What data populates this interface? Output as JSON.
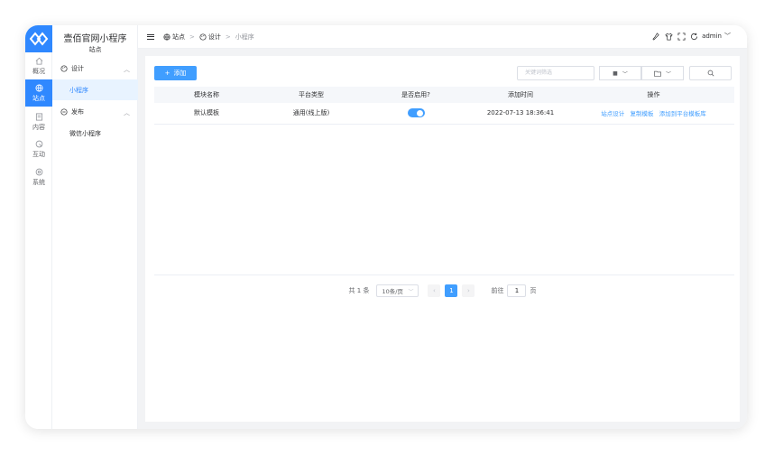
{
  "app": {
    "title": "壹佰官网小程序",
    "subtitle": "站点"
  },
  "rail": {
    "items": [
      {
        "label": "概况",
        "icon": "home-icon"
      },
      {
        "label": "站点",
        "icon": "globe-icon"
      },
      {
        "label": "内容",
        "icon": "content-icon"
      },
      {
        "label": "互动",
        "icon": "interact-icon"
      },
      {
        "label": "系统",
        "icon": "settings-icon"
      }
    ],
    "active_index": 1
  },
  "subnav": {
    "groups": [
      {
        "label": "设计",
        "icon": "palette-icon",
        "items": [
          {
            "label": "小程序",
            "active": true
          }
        ]
      },
      {
        "label": "发布",
        "icon": "publish-icon",
        "items": [
          {
            "label": "微信小程序",
            "active": false
          }
        ]
      }
    ]
  },
  "header": {
    "breadcrumb": [
      "站点",
      "设计",
      "小程序"
    ],
    "user": "admin"
  },
  "toolbar": {
    "add_label": "添加",
    "search_placeholder": "关键词筛选"
  },
  "table": {
    "columns": [
      "模块名称",
      "平台类型",
      "是否启用?",
      "添加时间",
      "操作"
    ],
    "rows": [
      {
        "name": "默认模板",
        "platform": "通用(线上版)",
        "enabled": true,
        "time": "2022-07-13 18:36:41",
        "actions": [
          "站点设计",
          "复制模板",
          "添加到平台模板库"
        ]
      }
    ]
  },
  "pagination": {
    "total": "共 1 条",
    "page_size": "10条/页",
    "current_page": "1",
    "goto_label": "前往",
    "goto_value": "1",
    "page_unit": "页"
  },
  "colors": {
    "primary": "#409eff",
    "rail_active": "#2f88ff",
    "sub_active_bg": "#e8f3ff"
  }
}
